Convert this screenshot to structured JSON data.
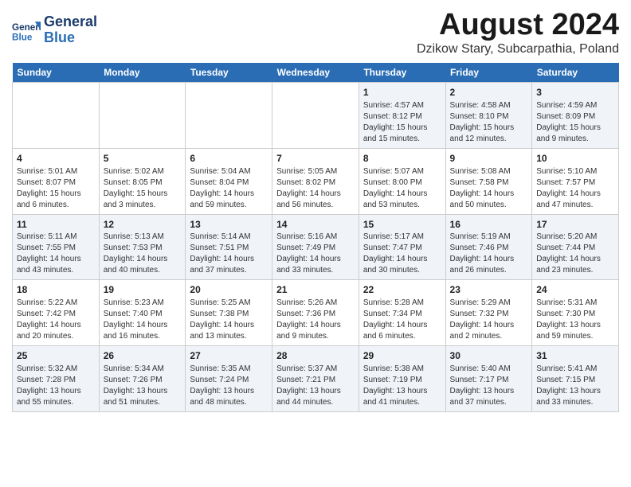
{
  "header": {
    "logo_line1": "General",
    "logo_line2": "Blue",
    "title": "August 2024",
    "subtitle": "Dzikow Stary, Subcarpathia, Poland"
  },
  "weekdays": [
    "Sunday",
    "Monday",
    "Tuesday",
    "Wednesday",
    "Thursday",
    "Friday",
    "Saturday"
  ],
  "weeks": [
    [
      {
        "day": "",
        "info": ""
      },
      {
        "day": "",
        "info": ""
      },
      {
        "day": "",
        "info": ""
      },
      {
        "day": "",
        "info": ""
      },
      {
        "day": "1",
        "info": "Sunrise: 4:57 AM\nSunset: 8:12 PM\nDaylight: 15 hours\nand 15 minutes."
      },
      {
        "day": "2",
        "info": "Sunrise: 4:58 AM\nSunset: 8:10 PM\nDaylight: 15 hours\nand 12 minutes."
      },
      {
        "day": "3",
        "info": "Sunrise: 4:59 AM\nSunset: 8:09 PM\nDaylight: 15 hours\nand 9 minutes."
      }
    ],
    [
      {
        "day": "4",
        "info": "Sunrise: 5:01 AM\nSunset: 8:07 PM\nDaylight: 15 hours\nand 6 minutes."
      },
      {
        "day": "5",
        "info": "Sunrise: 5:02 AM\nSunset: 8:05 PM\nDaylight: 15 hours\nand 3 minutes."
      },
      {
        "day": "6",
        "info": "Sunrise: 5:04 AM\nSunset: 8:04 PM\nDaylight: 14 hours\nand 59 minutes."
      },
      {
        "day": "7",
        "info": "Sunrise: 5:05 AM\nSunset: 8:02 PM\nDaylight: 14 hours\nand 56 minutes."
      },
      {
        "day": "8",
        "info": "Sunrise: 5:07 AM\nSunset: 8:00 PM\nDaylight: 14 hours\nand 53 minutes."
      },
      {
        "day": "9",
        "info": "Sunrise: 5:08 AM\nSunset: 7:58 PM\nDaylight: 14 hours\nand 50 minutes."
      },
      {
        "day": "10",
        "info": "Sunrise: 5:10 AM\nSunset: 7:57 PM\nDaylight: 14 hours\nand 47 minutes."
      }
    ],
    [
      {
        "day": "11",
        "info": "Sunrise: 5:11 AM\nSunset: 7:55 PM\nDaylight: 14 hours\nand 43 minutes."
      },
      {
        "day": "12",
        "info": "Sunrise: 5:13 AM\nSunset: 7:53 PM\nDaylight: 14 hours\nand 40 minutes."
      },
      {
        "day": "13",
        "info": "Sunrise: 5:14 AM\nSunset: 7:51 PM\nDaylight: 14 hours\nand 37 minutes."
      },
      {
        "day": "14",
        "info": "Sunrise: 5:16 AM\nSunset: 7:49 PM\nDaylight: 14 hours\nand 33 minutes."
      },
      {
        "day": "15",
        "info": "Sunrise: 5:17 AM\nSunset: 7:47 PM\nDaylight: 14 hours\nand 30 minutes."
      },
      {
        "day": "16",
        "info": "Sunrise: 5:19 AM\nSunset: 7:46 PM\nDaylight: 14 hours\nand 26 minutes."
      },
      {
        "day": "17",
        "info": "Sunrise: 5:20 AM\nSunset: 7:44 PM\nDaylight: 14 hours\nand 23 minutes."
      }
    ],
    [
      {
        "day": "18",
        "info": "Sunrise: 5:22 AM\nSunset: 7:42 PM\nDaylight: 14 hours\nand 20 minutes."
      },
      {
        "day": "19",
        "info": "Sunrise: 5:23 AM\nSunset: 7:40 PM\nDaylight: 14 hours\nand 16 minutes."
      },
      {
        "day": "20",
        "info": "Sunrise: 5:25 AM\nSunset: 7:38 PM\nDaylight: 14 hours\nand 13 minutes."
      },
      {
        "day": "21",
        "info": "Sunrise: 5:26 AM\nSunset: 7:36 PM\nDaylight: 14 hours\nand 9 minutes."
      },
      {
        "day": "22",
        "info": "Sunrise: 5:28 AM\nSunset: 7:34 PM\nDaylight: 14 hours\nand 6 minutes."
      },
      {
        "day": "23",
        "info": "Sunrise: 5:29 AM\nSunset: 7:32 PM\nDaylight: 14 hours\nand 2 minutes."
      },
      {
        "day": "24",
        "info": "Sunrise: 5:31 AM\nSunset: 7:30 PM\nDaylight: 13 hours\nand 59 minutes."
      }
    ],
    [
      {
        "day": "25",
        "info": "Sunrise: 5:32 AM\nSunset: 7:28 PM\nDaylight: 13 hours\nand 55 minutes."
      },
      {
        "day": "26",
        "info": "Sunrise: 5:34 AM\nSunset: 7:26 PM\nDaylight: 13 hours\nand 51 minutes."
      },
      {
        "day": "27",
        "info": "Sunrise: 5:35 AM\nSunset: 7:24 PM\nDaylight: 13 hours\nand 48 minutes."
      },
      {
        "day": "28",
        "info": "Sunrise: 5:37 AM\nSunset: 7:21 PM\nDaylight: 13 hours\nand 44 minutes."
      },
      {
        "day": "29",
        "info": "Sunrise: 5:38 AM\nSunset: 7:19 PM\nDaylight: 13 hours\nand 41 minutes."
      },
      {
        "day": "30",
        "info": "Sunrise: 5:40 AM\nSunset: 7:17 PM\nDaylight: 13 hours\nand 37 minutes."
      },
      {
        "day": "31",
        "info": "Sunrise: 5:41 AM\nSunset: 7:15 PM\nDaylight: 13 hours\nand 33 minutes."
      }
    ]
  ]
}
